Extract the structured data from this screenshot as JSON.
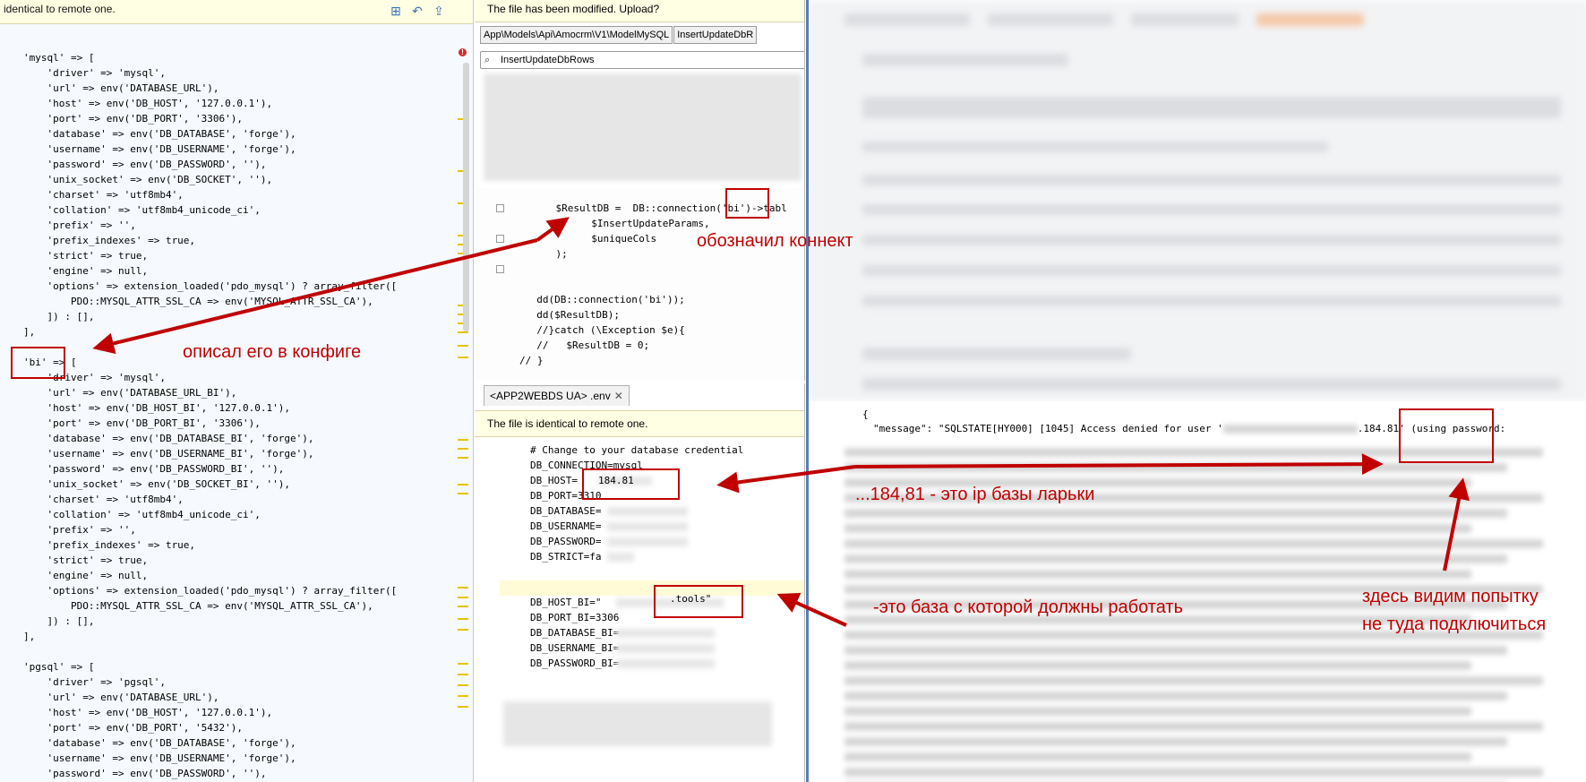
{
  "left_panel": {
    "banner_text": "identical to remote one.",
    "toolbar": {
      "icon1": "diff-icon",
      "icon2": "undo-icon",
      "icon3": "upload-icon"
    },
    "code_lines": [
      "'mysql' => [",
      "    'driver' => 'mysql',",
      "    'url' => env('DATABASE_URL'),",
      "    'host' => env('DB_HOST', '127.0.0.1'),",
      "    'port' => env('DB_PORT', '3306'),",
      "    'database' => env('DB_DATABASE', 'forge'),",
      "    'username' => env('DB_USERNAME', 'forge'),",
      "    'password' => env('DB_PASSWORD', ''),",
      "    'unix_socket' => env('DB_SOCKET', ''),",
      "    'charset' => 'utf8mb4',",
      "    'collation' => 'utf8mb4_unicode_ci',",
      "    'prefix' => '',",
      "    'prefix_indexes' => true,",
      "    'strict' => true,",
      "    'engine' => null,",
      "    'options' => extension_loaded('pdo_mysql') ? array_filter([",
      "        PDO::MYSQL_ATTR_SSL_CA => env('MYSQL_ATTR_SSL_CA'),",
      "    ]) : [],",
      "],",
      "",
      "'bi' => [",
      "    'driver' => 'mysql',",
      "    'url' => env('DATABASE_URL_BI'),",
      "    'host' => env('DB_HOST_BI', '127.0.0.1'),",
      "    'port' => env('DB_PORT_BI', '3306'),",
      "    'database' => env('DB_DATABASE_BI', 'forge'),",
      "    'username' => env('DB_USERNAME_BI', 'forge'),",
      "    'password' => env('DB_PASSWORD_BI', ''),",
      "    'unix_socket' => env('DB_SOCKET_BI', ''),",
      "    'charset' => 'utf8mb4',",
      "    'collation' => 'utf8mb4_unicode_ci',",
      "    'prefix' => '',",
      "    'prefix_indexes' => true,",
      "    'strict' => true,",
      "    'engine' => null,",
      "    'options' => extension_loaded('pdo_mysql') ? array_filter([",
      "        PDO::MYSQL_ATTR_SSL_CA => env('MYSQL_ATTR_SSL_CA'),",
      "    ]) : [],",
      "],",
      "",
      "'pgsql' => [",
      "    'driver' => 'pgsql',",
      "    'url' => env('DATABASE_URL'),",
      "    'host' => env('DB_HOST', '127.0.0.1'),",
      "    'port' => env('DB_PORT', '5432'),",
      "    'database' => env('DB_DATABASE', 'forge'),",
      "    'username' => env('DB_USERNAME', 'forge'),",
      "    'password' => env('DB_PASSWORD', ''),"
    ]
  },
  "middle_top": {
    "banner_text": "The file has been modified. Upload?",
    "breadcrumb": [
      "App\\Models\\Api\\Amocrm\\V1\\ModelMySQL",
      "InsertUpdateDbR"
    ],
    "search_value": "InsertUpdateDbRows",
    "code_lines": [
      "    $ResultDB =  DB::connection('bi')->tabl",
      "          $InsertUpdateParams,",
      "          $uniqueCols",
      "    );",
      "",
      "",
      "  dd(DB::connection('bi'));",
      "  dd($ResultDB);",
      "  //}catch (\\Exception $e){",
      "  //   $ResultDB = 0;",
      "// }"
    ]
  },
  "middle_bottom": {
    "tab_label": "<APP2WEBDS UA> .env",
    "banner_text": "The file is identical to remote one.",
    "env_lines": [
      "# Change to your database credential",
      "DB_CONNECTION=mysql",
      "DB_HOST=",
      "DB_PORT=3310",
      "DB_DATABASE=",
      "DB_USERNAME=",
      "DB_PASSWORD=",
      "DB_STRICT=fa",
      "",
      "",
      "DB_HOST_BI=\"",
      "DB_PORT_BI=3306",
      "DB_DATABASE_BI=",
      "DB_USERNAME_BI=",
      "DB_PASSWORD_BI="
    ],
    "host_suffix": "184.81",
    "host_bi_suffix": ".tools\""
  },
  "right_panel": {
    "bracket": "{",
    "json_message_prefix": "\"message\": \"SQLSTATE[HY000] [1045] Access denied for user '",
    "json_message_ip": ".184.81",
    "json_message_suffix": "' (using password:"
  },
  "annotations": {
    "connect": "обозначил коннект",
    "config": "описал его в конфиге",
    "ip_note": "...184,81 - это  ip базы ларьки",
    "target_db": "-это база с которой должны работать",
    "attempt_line1": "здесь видим попытку",
    "attempt_line2": "не туда подключиться"
  },
  "colors": {
    "annotation": "#c00000",
    "banner": "#ffffe3",
    "string": "#067d17"
  }
}
